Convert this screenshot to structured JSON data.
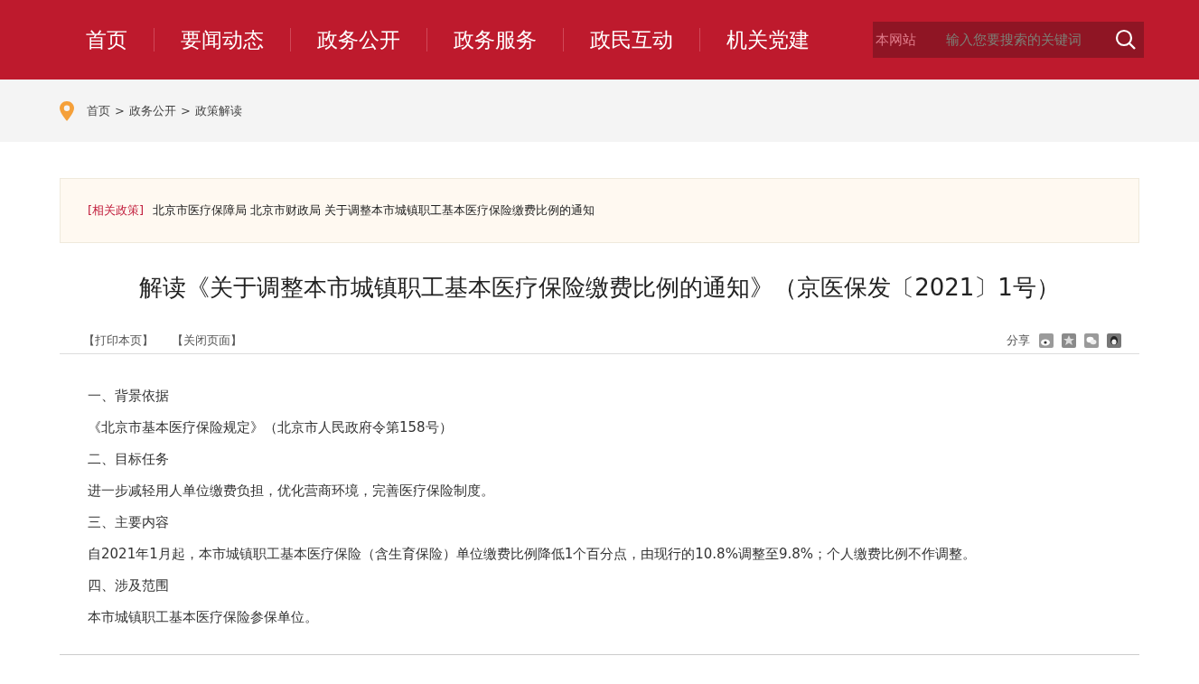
{
  "nav": {
    "items": [
      "首页",
      "要闻动态",
      "政务公开",
      "政务服务",
      "政民互动",
      "机关党建"
    ]
  },
  "search": {
    "scope": "本网站",
    "placeholder": "输入您要搜索的关键词"
  },
  "breadcrumb": [
    "首页",
    ">",
    "政务公开",
    ">",
    "政策解读"
  ],
  "related": {
    "tag": "[相关政策]",
    "text": "北京市医疗保障局 北京市财政局 关于调整本市城镇职工基本医疗保险缴费比例的通知"
  },
  "article": {
    "title": "解读《关于调整本市城镇职工基本医疗保险缴费比例的通知》（京医保发〔2021〕1号）",
    "tools": [
      "【打印本页】",
      "【关闭页面】"
    ],
    "share_label": "分享",
    "paragraphs": [
      "一、背景依据",
      "《北京市基本医疗保险规定》（北京市人民政府令第158号）",
      "二、目标任务",
      "进一步减轻用人单位缴费负担，优化营商环境，完善医疗保险制度。",
      "三、主要内容",
      "自2021年1月起，本市城镇职工基本医疗保险（含生育保险）单位缴费比例降低1个百分点，由现行的10.8%调整至9.8%；个人缴费比例不作调整。",
      "四、涉及范围",
      "本市城镇职工基本医疗保险参保单位。"
    ]
  }
}
